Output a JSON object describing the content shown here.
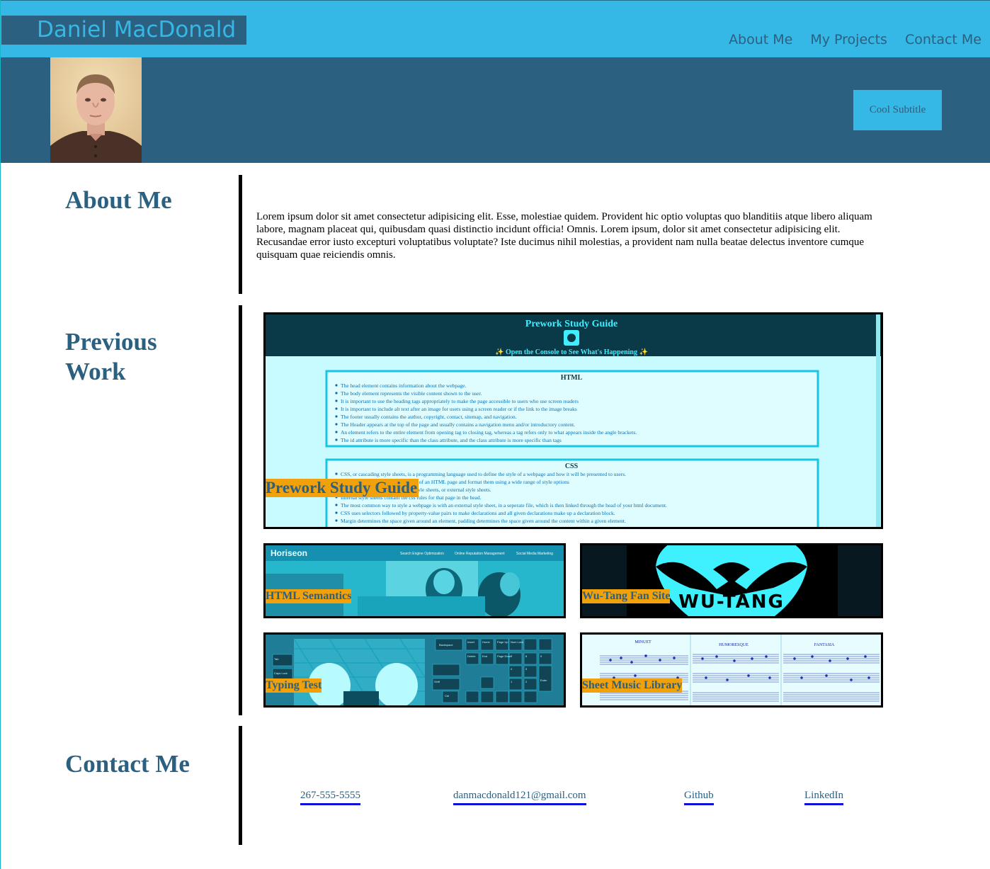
{
  "header": {
    "name": "Daniel MacDonald",
    "nav": [
      "About Me",
      "My Projects",
      "Contact Me"
    ]
  },
  "banner": {
    "subtitle": "Cool Subtitle"
  },
  "about": {
    "title": "About Me",
    "text": "Lorem ipsum dolor sit amet consectetur adipisicing elit. Esse, molestiae quidem. Provident hic optio voluptas quo blanditiis atque libero aliquam labore, magnam placeat qui, quibusdam quasi distinctio incidunt officia! Omnis. Lorem ipsum, dolor sit amet consectetur adipisicing elit. Recusandae error iusto excepturi voluptatibus voluptate? Iste ducimus nihil molestias, a provident nam nulla beatae delectus inventore cumque quisquam quae reiciendis omnis."
  },
  "work": {
    "title": "Previous Work",
    "featured": {
      "label": "Prework Study Guide",
      "preview": {
        "heading": "Prework Study Guide",
        "console_note": "✨ Open the Console to See What's Happening ✨",
        "html_heading": "HTML",
        "html_items": [
          "The head element contains information about the webpage.",
          "The body element represents the visible content shown to the user.",
          "It is important to use the heading tags appropriately to make the page accessible to users who use screen readers",
          "It is important to include alt text after an image for users using a screen reader or if the link to the image breaks",
          "The footer usually contains the author, copyright, contact, sitemap, and navigation.",
          "The Header appears at the top of the page and usually contains a navigation menu and/or introductory content.",
          "An element refers to the entire element from opening tag to closing tag, whereas a tag refers only to what appears inside the angle brackets.",
          "The id attribute is more specific than the class attribute, and the class attribute is more specific than tags"
        ],
        "css_heading": "CSS",
        "css_items": [
          "CSS, or cascading style sheets, is a programming language used to define the style of a webpage and how it will be presented to users.",
          "CSS uses rules for specific elements of an HTML page and format them using a wide range of style options",
          "CSS can be inline css, internal css style sheets, or external style sheets.",
          "Internal style sheets contain the css rules for that page in the head.",
          "The most common way to style a webpage is with an external style sheet, in a seperate file, which is then linked through the head of your html document.",
          "CSS uses selectors followed by property-value pairs to make declarations and all given declarations make up a declaration block.",
          "Margin determines the space given around an element, padding determines the space given around the content within a given element."
        ]
      }
    },
    "projects": [
      {
        "label": "HTML Semantics",
        "preview": {
          "brand": "Horiseon",
          "menu": [
            "Search Engine Optimization",
            "Online Reputation Management",
            "Social Media Marketing"
          ]
        }
      },
      {
        "label": "Wu-Tang Fan Site",
        "preview": {
          "logo_text": "WU-TANG"
        }
      },
      {
        "label": "Typing Test",
        "preview": {
          "keys": [
            "Backspace",
            "Insert",
            "Home",
            "Page Up",
            "Num Lock",
            "Delete",
            "End",
            "Page Down",
            "Enter",
            "Shift",
            "Ctrl",
            "Caps Lock",
            "Tab",
            "7",
            "8",
            "9",
            "4",
            "5",
            "6",
            "1",
            "2",
            "3",
            "0",
            "Home",
            "PgUp",
            "End",
            "PgDn"
          ]
        }
      },
      {
        "label": "Sheet Music Library",
        "preview": {
          "titles": [
            "MINUET",
            "HUMORESQUE",
            "FANTASIA"
          ]
        }
      }
    ]
  },
  "contact": {
    "title": "Contact Me",
    "phone": "267-555-5555",
    "email": "danmacdonald121@gmail.com",
    "github": "Github",
    "linkedin": "LinkedIn"
  },
  "colors": {
    "header_bg": "#35b8e6",
    "banner_bg": "#2b6080",
    "accent_text": "#2b6080",
    "project_label_bg": "#f0a10c",
    "link_underline": "#0d10d6"
  }
}
